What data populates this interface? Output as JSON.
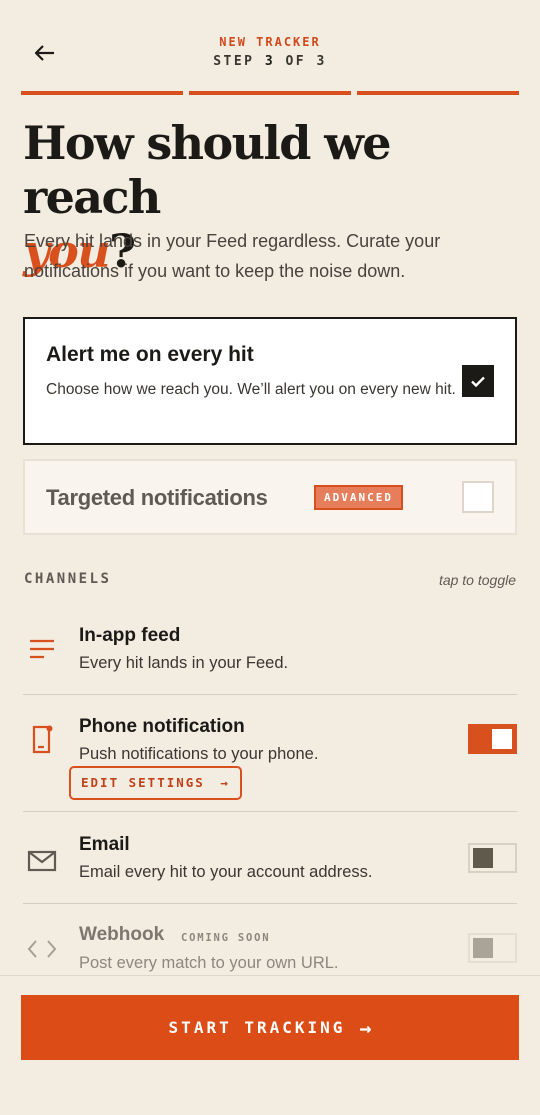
{
  "header": {
    "eyebrow": "NEW TRACKER",
    "step_prefix": "STEP",
    "step_current": "3",
    "step_of": "OF",
    "step_total": "3",
    "progress_segments": 3,
    "progress_completed": 3
  },
  "title": {
    "line": "How should we reach",
    "accent": "you",
    "end": "?"
  },
  "subtitle": "Every hit lands in your Feed regardless. Curate your notifications if you want to keep the noise down.",
  "options": {
    "every_hit": {
      "title": "Alert me on every hit",
      "description": "Choose how we reach you. We’ll alert you on every new hit.",
      "checked": true
    },
    "targeted": {
      "title": "Targeted notifications",
      "badge": "ADVANCED",
      "checked": false
    }
  },
  "channels": {
    "label": "CHANNELS",
    "hint": "tap to toggle",
    "items": [
      {
        "name": "In-app feed",
        "description": "Every hit lands in your Feed.",
        "icon": "menu-lines-icon"
      },
      {
        "name": "Phone notification",
        "description": "Push notifications to your phone.",
        "icon": "phone-icon",
        "enabled": true,
        "edit_label": "EDIT SETTINGS",
        "edit_arrow": "→"
      },
      {
        "name": "Email",
        "description": "Email every hit to your account address.",
        "icon": "envelope-icon",
        "enabled": false
      },
      {
        "name": "Webhook",
        "badge": "COMING SOON",
        "description": "Post every match to your own URL.",
        "icon": "code-brackets-icon",
        "enabled": false,
        "disabled": true
      }
    ]
  },
  "cta": {
    "label": "START TRACKING",
    "arrow": "→"
  },
  "colors": {
    "accent": "#d9501f",
    "background": "#f3ece1",
    "ink": "#1c1a17"
  }
}
